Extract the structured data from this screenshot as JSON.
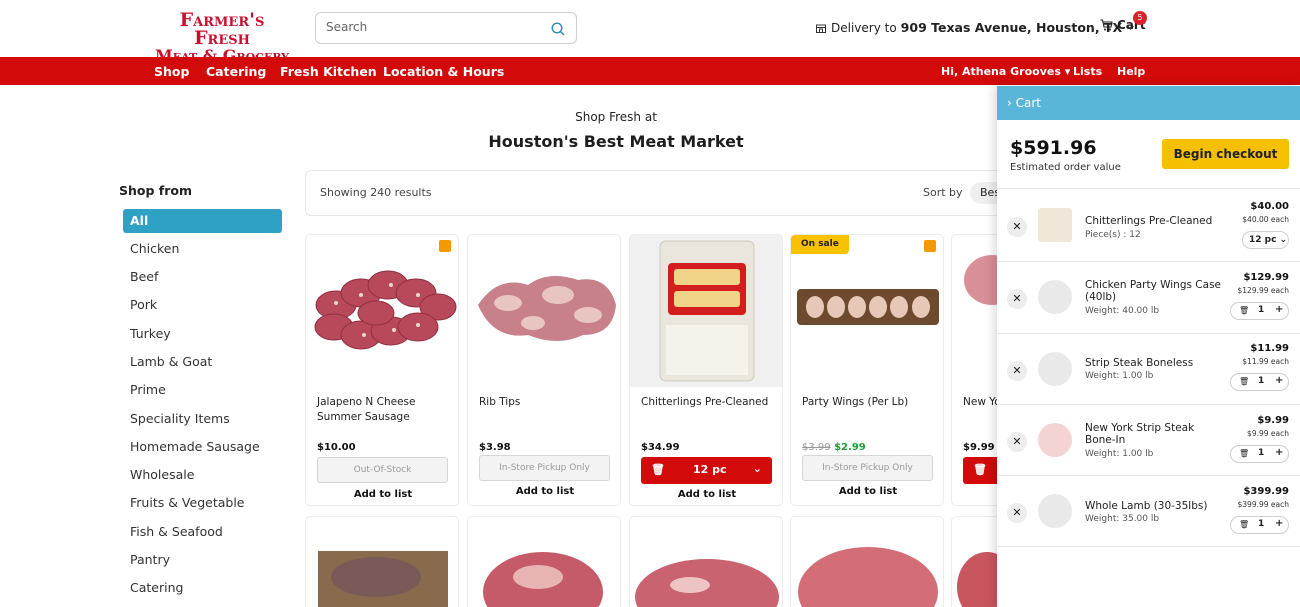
{
  "header": {
    "logo_line1": "Farmer's Fresh",
    "logo_line2": "Meat & Grocery",
    "search_placeholder": "Search",
    "delivery_prefix": "Delivery to",
    "delivery_address": "909 Texas Avenue, Houston, TX",
    "cart_label": "Cart",
    "cart_count": "5"
  },
  "nav": {
    "items": [
      "Shop",
      "Catering",
      "Fresh Kitchen",
      "Location & Hours"
    ],
    "user_greeting": "Hi, Athena Grooves",
    "lists": "Lists",
    "help": "Help"
  },
  "hero": {
    "subtitle": "Shop Fresh at",
    "title": "Houston's Best Meat Market"
  },
  "sidebar": {
    "heading": "Shop from",
    "categories": [
      "All",
      "Chicken",
      "Beef",
      "Pork",
      "Turkey",
      "Lamb & Goat",
      "Prime",
      "Speciality Items",
      "Homemade Sausage",
      "Wholesale",
      "Fruits & Vegetable",
      "Fish & Seafood",
      "Pantry",
      "Catering"
    ]
  },
  "results": {
    "count_text": "Showing 240 results",
    "sort_label": "Sort by",
    "sort_value": "Bes"
  },
  "products": [
    {
      "name": "Jalapeno N Cheese Summer Sausage",
      "price": "$10.00",
      "action": "Out-Of-Stock",
      "add_to_list": "Add to list"
    },
    {
      "name": "Rib Tips",
      "price": "$3.98",
      "action": "In-Store Pickup Only",
      "add_to_list": "Add to list"
    },
    {
      "name": "Chitterlings Pre-Cleaned",
      "price": "$34.99",
      "qty": "12 pc",
      "add_to_list": "Add to list"
    },
    {
      "name": "Party Wings (Per Lb)",
      "old_price": "$3.99",
      "sale_price": "$2.99",
      "badge": "On sale",
      "action": "In-Store Pickup Only",
      "add_to_list": "Add to list"
    },
    {
      "name": "New Yo Bone-I",
      "price": "$9.99"
    }
  ],
  "cart": {
    "header": "Cart",
    "total": "$591.96",
    "total_label": "Estimated order value",
    "checkout_label": "Begin checkout",
    "items": [
      {
        "name": "Chitterlings Pre-Cleaned",
        "sub": "Piece(s) : 12",
        "price": "$40.00",
        "each": "$40.00 each",
        "qty": "12 pc"
      },
      {
        "name": "Chicken Party Wings Case (40lb)",
        "sub": "Weight: 40.00 lb",
        "price": "$129.99",
        "each": "$129.99 each",
        "qty": "1"
      },
      {
        "name": "Strip Steak Boneless",
        "sub": "Weight: 1.00 lb",
        "price": "$11.99",
        "each": "$11.99 each",
        "qty": "1"
      },
      {
        "name": "New York Strip Steak Bone-In",
        "sub": "Weight: 1.00 lb",
        "price": "$9.99",
        "each": "$9.99 each",
        "qty": "1"
      },
      {
        "name": "Whole Lamb (30-35lbs)",
        "sub": "Weight: 35.00 lb",
        "price": "$399.99",
        "each": "$399.99 each",
        "qty": "1"
      }
    ]
  },
  "colors": {
    "brand_red": "#d20a0a",
    "accent_blue": "#2fa1c5",
    "cart_header": "#5ab6d8",
    "checkout_yellow": "#f5c000",
    "sale_green": "#1e9e3a"
  }
}
